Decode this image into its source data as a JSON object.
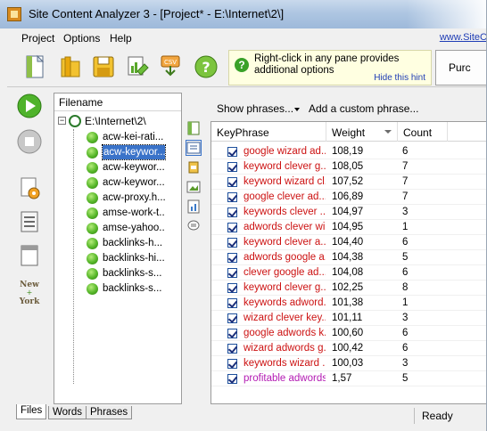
{
  "window": {
    "title": "Site Content Analyzer 3 - [Project* - E:\\Internet\\2\\]"
  },
  "menu": {
    "items": [
      "Project",
      "Options",
      "Help"
    ],
    "link": "www.SiteC"
  },
  "toolbar": {
    "hint_text": "Right-click in any pane provides additional options",
    "hint_hide": "Hide this hint",
    "purchase_label": "Purc"
  },
  "tree": {
    "header": "Filename",
    "root": "E:\\Internet\\2\\",
    "files": [
      "acw-kei-rati...",
      "acw-keywor...",
      "acw-keywor...",
      "acw-keywor...",
      "acw-proxy.h...",
      "amse-work-t...",
      "amse-yahoo...",
      "backlinks-h...",
      "backlinks-hi...",
      "backlinks-s...",
      "backlinks-s..."
    ],
    "selected_index": 1
  },
  "tabs": [
    "Files",
    "Words",
    "Phrases"
  ],
  "status": "Ready",
  "phrases": {
    "show_label": "Show phrases...",
    "add_label": "Add a custom phrase...",
    "columns": [
      "KeyPhrase",
      "Weight",
      "Count"
    ],
    "rows": [
      {
        "phrase": "google wizard ad...",
        "weight": "108,19",
        "count": "6",
        "color": "#cc1111"
      },
      {
        "phrase": "keyword clever g...",
        "weight": "108,05",
        "count": "7",
        "color": "#cc1111"
      },
      {
        "phrase": "keyword wizard cl...",
        "weight": "107,52",
        "count": "7",
        "color": "#cc1111"
      },
      {
        "phrase": "google clever ad...",
        "weight": "106,89",
        "count": "7",
        "color": "#cc1111"
      },
      {
        "phrase": "keywords clever ...",
        "weight": "104,97",
        "count": "3",
        "color": "#cc1111"
      },
      {
        "phrase": "adwords clever wi...",
        "weight": "104,95",
        "count": "1",
        "color": "#cc1111"
      },
      {
        "phrase": "keyword clever a...",
        "weight": "104,40",
        "count": "6",
        "color": "#cc1111"
      },
      {
        "phrase": "adwords google a...",
        "weight": "104,38",
        "count": "5",
        "color": "#cc1111"
      },
      {
        "phrase": "clever google ad...",
        "weight": "104,08",
        "count": "6",
        "color": "#cc1111"
      },
      {
        "phrase": "keyword clever g...",
        "weight": "102,25",
        "count": "8",
        "color": "#cc1111"
      },
      {
        "phrase": "keywords adword...",
        "weight": "101,38",
        "count": "1",
        "color": "#cc1111"
      },
      {
        "phrase": "wizard clever key...",
        "weight": "101,11",
        "count": "3",
        "color": "#cc1111"
      },
      {
        "phrase": "google adwords k...",
        "weight": "100,60",
        "count": "6",
        "color": "#cc1111"
      },
      {
        "phrase": "wizard adwords g...",
        "weight": "100,42",
        "count": "6",
        "color": "#cc1111"
      },
      {
        "phrase": "keywords wizard ...",
        "weight": "100,03",
        "count": "3",
        "color": "#cc1111"
      },
      {
        "phrase": "profitable adwords",
        "weight": "1,57",
        "count": "5",
        "color": "#b31ab3"
      }
    ]
  }
}
